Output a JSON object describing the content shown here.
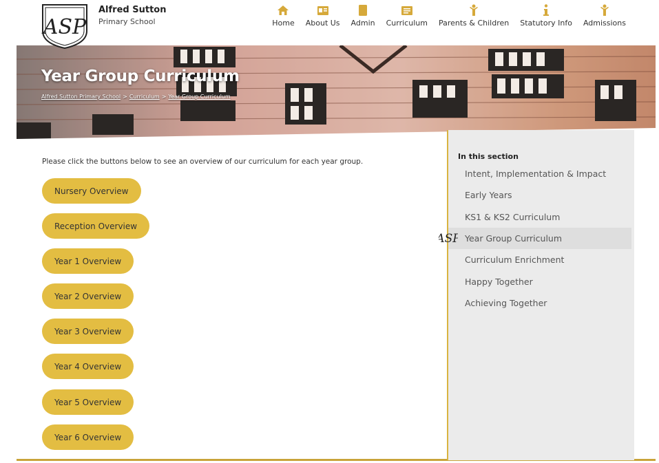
{
  "school": {
    "name": "Alfred Sutton",
    "subtitle": "Primary School",
    "logo_text": "ASP"
  },
  "nav": {
    "items": [
      {
        "label": "Home",
        "icon": "home-icon"
      },
      {
        "label": "About Us",
        "icon": "id-card-icon"
      },
      {
        "label": "Admin",
        "icon": "clipboard-icon"
      },
      {
        "label": "Curriculum",
        "icon": "book-icon"
      },
      {
        "label": "Parents & Children",
        "icon": "child-icon"
      },
      {
        "label": "Statutory Info",
        "icon": "info-icon"
      },
      {
        "label": "Admissions",
        "icon": "person-icon"
      }
    ]
  },
  "banner": {
    "title": "Year Group Curriculum",
    "breadcrumb": [
      "Alfred Sutton Primary School",
      "Curriculum",
      "Year Group Curriculum"
    ]
  },
  "main": {
    "intro": "Please click the buttons below to see an overview of our curriculum for each year group.",
    "buttons": [
      "Nursery Overview",
      "Reception Overview",
      "Year 1 Overview",
      "Year 2 Overview",
      "Year 3 Overview",
      "Year 4 Overview",
      "Year 5 Overview",
      "Year 6 Overview"
    ]
  },
  "sidebar": {
    "heading": "In this section",
    "items": [
      "Intent, Implementation & Impact",
      "Early Years",
      "KS1 & KS2 Curriculum",
      "Year Group Curriculum",
      "Curriculum Enrichment",
      "Happy Together",
      "Achieving Together"
    ],
    "active_item": "Year Group Curriculum"
  },
  "colors": {
    "accent": "#e3bd42",
    "nav_icon": "#d6a93a",
    "sidebar_bg": "#ebebeb"
  }
}
